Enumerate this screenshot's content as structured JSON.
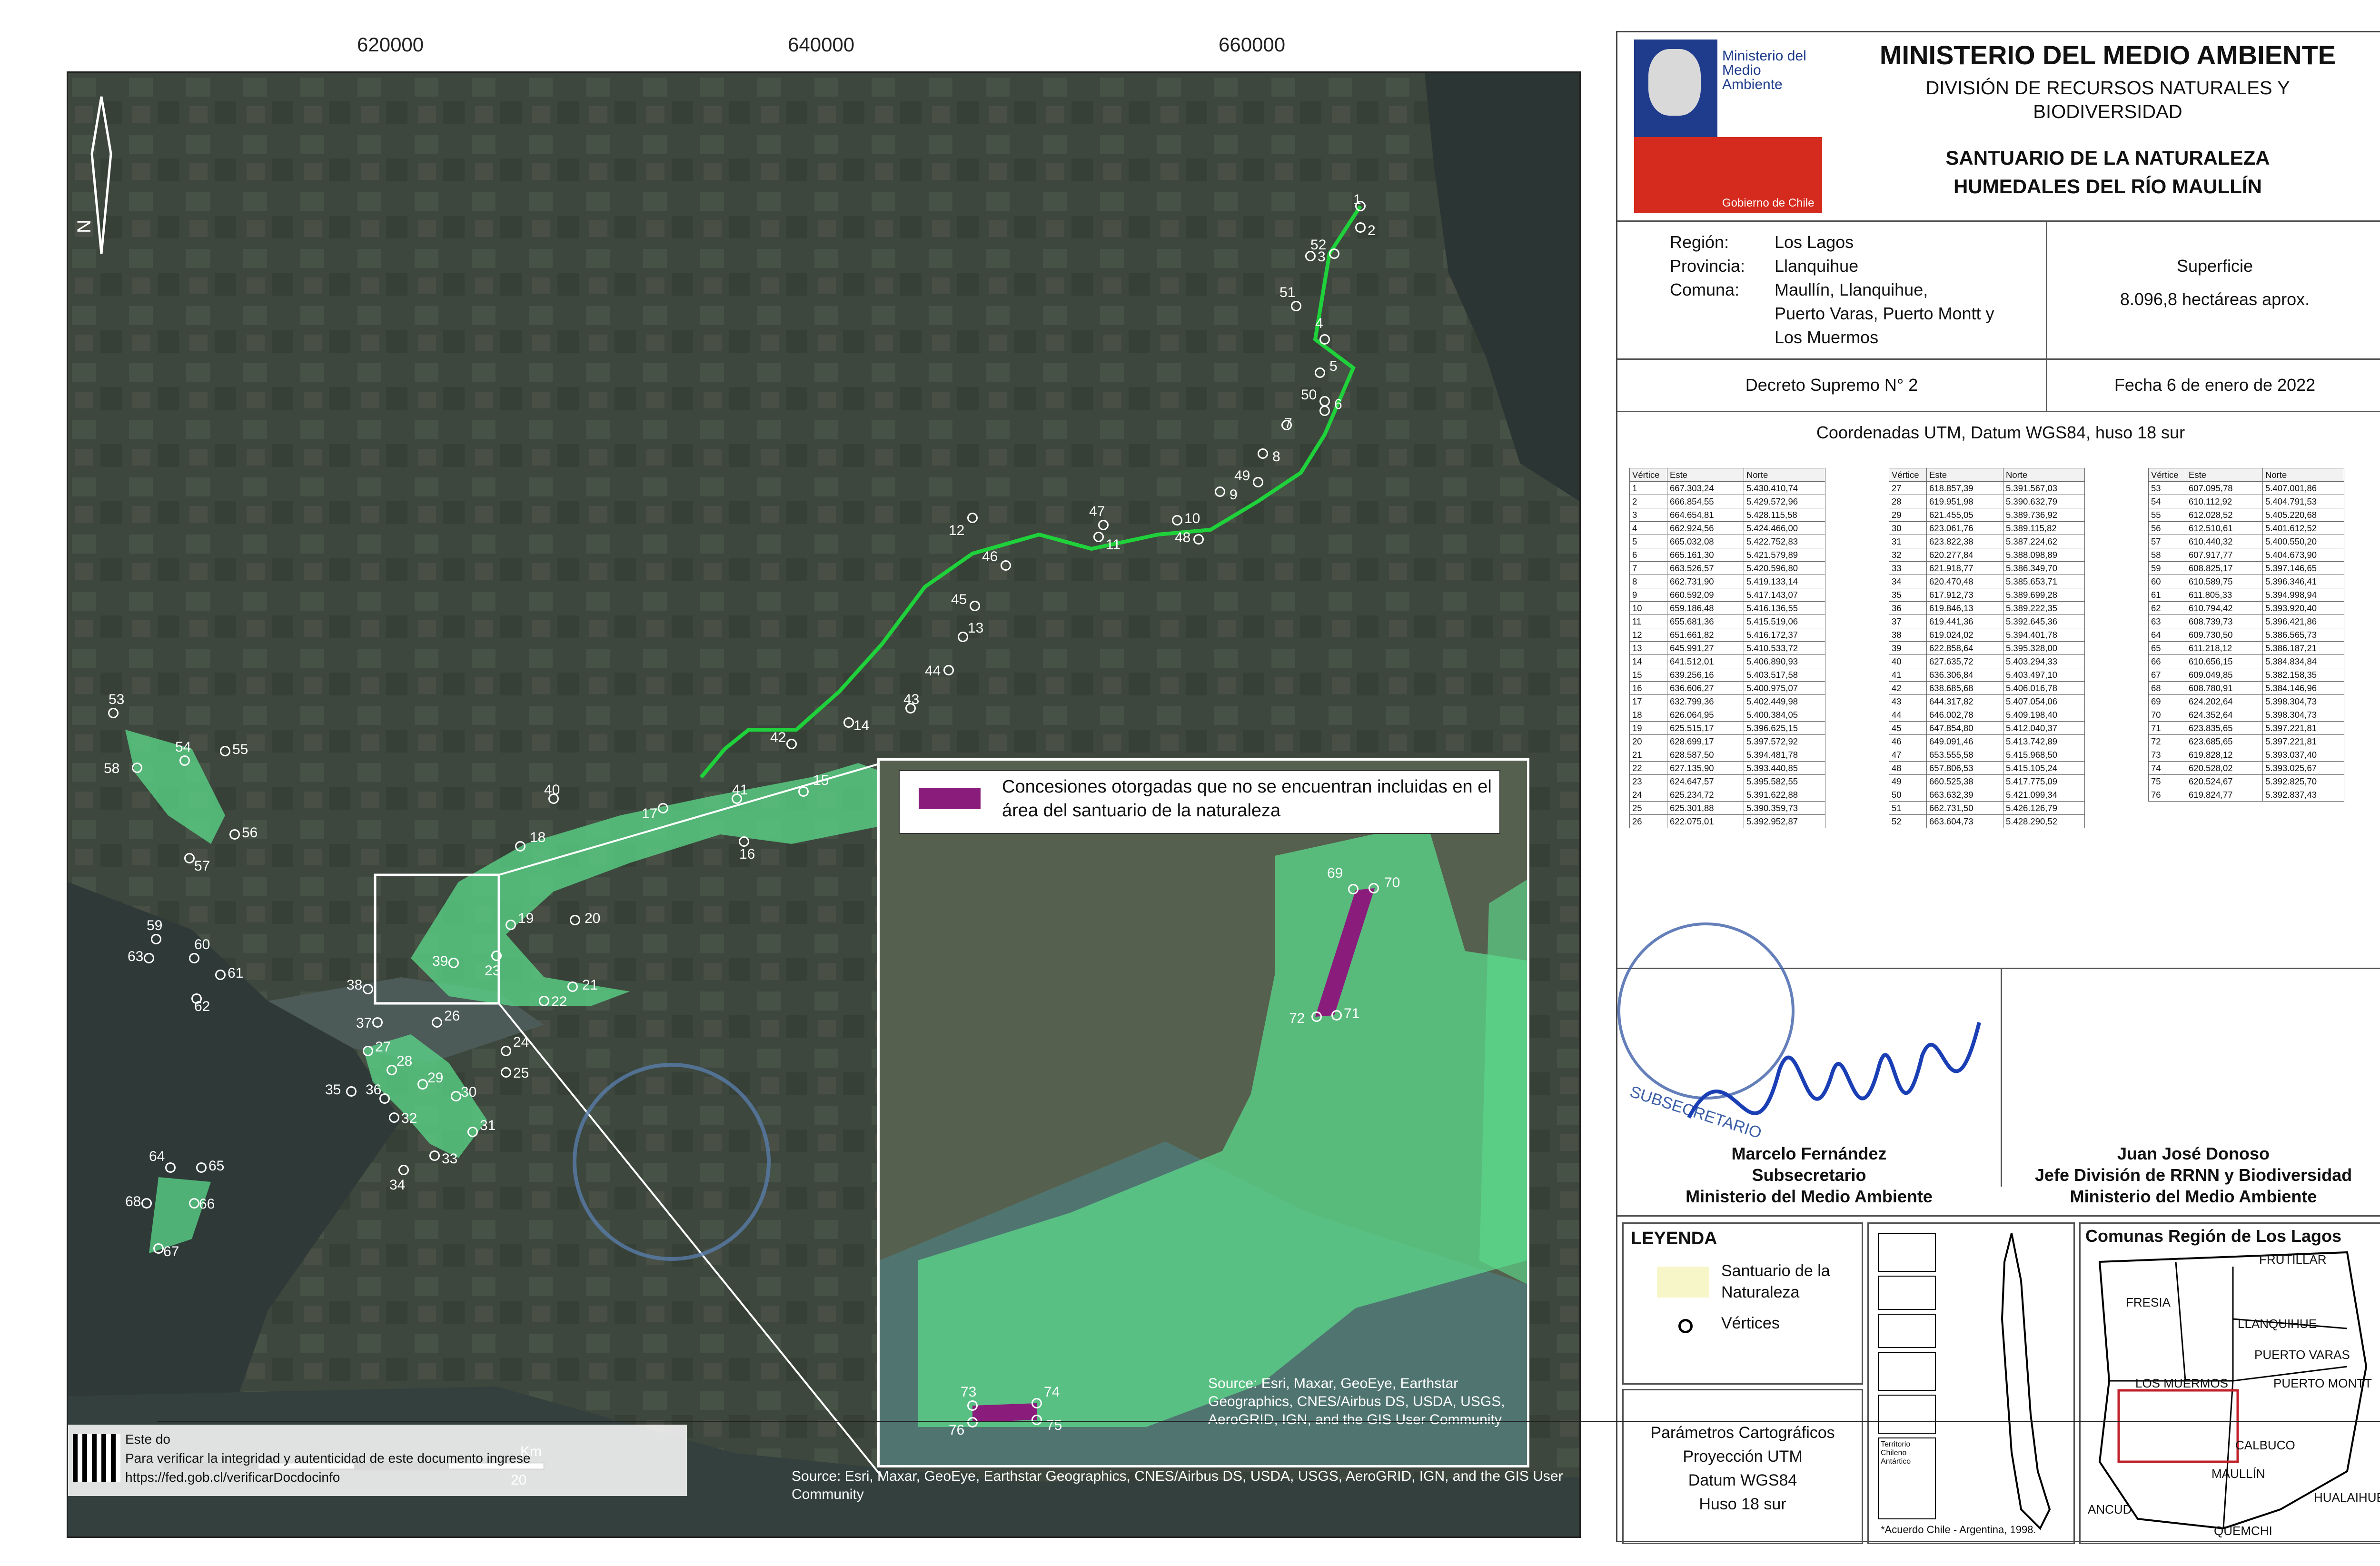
{
  "map": {
    "x_ticks": [
      "620000",
      "640000",
      "660000"
    ],
    "north_label": "N",
    "inset_legend": "Concesiones otorgadas que no se encuentran incluidas en el área del santuario de la naturaleza",
    "inset_attribution": "Source: Esri, Maxar, GeoEye, Earthstar Geographics, CNES/Airbus DS, USDA, USGS, AeroGRID, IGN, and the GIS User Community",
    "map_attribution": "Source: Esri, Maxar, GeoEye, Earthstar Geographics, CNES/Airbus DS, USDA, USGS, AeroGRID, IGN, and the GIS User Community",
    "scale_unit": "Km",
    "scale_value": "20",
    "verify_line1": "Este do",
    "verify_line2": "Para verificar la integridad y autenticidad de este documento ingrese",
    "verify_url": "https://fed.gob.cl/verificarDocdocinfo",
    "colors": {
      "sanctuary": "#5bd98a",
      "route": "#1fd13a",
      "concession": "#8a1c7c"
    }
  },
  "header": {
    "logo_text": "Ministerio del Medio Ambiente",
    "logo_footer": "Gobierno de Chile",
    "ministry": "MINISTERIO DEL MEDIO AMBIENTE",
    "division_line1": "DIVISIÓN DE RECURSOS NATURALES Y",
    "division_line2": "BIODIVERSIDAD",
    "title_line1": "SANTUARIO DE LA NATURALEZA",
    "title_line2": "HUMEDALES DEL RÍO MAULLÍN"
  },
  "info": {
    "region_label": "Región:",
    "region_value": "Los Lagos",
    "provincia_label": "Provincia:",
    "provincia_value": "Llanquihue",
    "comuna_label": "Comuna:",
    "comuna_value_line1": "Maullín, Llanquihue,",
    "comuna_value_line2": "Puerto Varas, Puerto Montt y",
    "comuna_value_line3": "Los Muermos",
    "superficie_label": "Superficie",
    "superficie_value": "8.096,8 hectáreas aprox.",
    "decreto": "Decreto Supremo N° 2",
    "fecha": "Fecha 6 de enero de 2022",
    "coords_title": "Coordenadas UTM, Datum WGS84, huso 18 sur"
  },
  "coords_headers": [
    "Vértice",
    "Este",
    "Norte"
  ],
  "coords": [
    [
      "1",
      "667.303,24",
      "5.430.410,74"
    ],
    [
      "2",
      "666.854,55",
      "5.429.572,96"
    ],
    [
      "3",
      "664.654,81",
      "5.428.115,58"
    ],
    [
      "4",
      "662.924,56",
      "5.424.466,00"
    ],
    [
      "5",
      "665.032,08",
      "5.422.752,83"
    ],
    [
      "6",
      "665.161,30",
      "5.421.579,89"
    ],
    [
      "7",
      "663.526,57",
      "5.420.596,80"
    ],
    [
      "8",
      "662.731,90",
      "5.419.133,14"
    ],
    [
      "9",
      "660.592,09",
      "5.417.143,07"
    ],
    [
      "10",
      "659.186,48",
      "5.416.136,55"
    ],
    [
      "11",
      "655.681,36",
      "5.415.519,06"
    ],
    [
      "12",
      "651.661,82",
      "5.416.172,37"
    ],
    [
      "13",
      "645.991,27",
      "5.410.533,72"
    ],
    [
      "14",
      "641.512,01",
      "5.406.890,93"
    ],
    [
      "15",
      "639.256,16",
      "5.403.517,58"
    ],
    [
      "16",
      "636.606,27",
      "5.400.975,07"
    ],
    [
      "17",
      "632.799,36",
      "5.402.449,98"
    ],
    [
      "18",
      "626.064,95",
      "5.400.384,05"
    ],
    [
      "19",
      "625.515,17",
      "5.396.625,15"
    ],
    [
      "20",
      "628.699,17",
      "5.397.572,92"
    ],
    [
      "21",
      "628.587,50",
      "5.394.481,78"
    ],
    [
      "22",
      "627.135,90",
      "5.393.440,85"
    ],
    [
      "23",
      "624.647,57",
      "5.395.582,55"
    ],
    [
      "24",
      "625.234,72",
      "5.391.622,88"
    ],
    [
      "25",
      "625.301,88",
      "5.390.359,73"
    ],
    [
      "26",
      "622.075,01",
      "5.392.952,87"
    ],
    [
      "27",
      "618.857,39",
      "5.391.567,03"
    ],
    [
      "28",
      "619.951,98",
      "5.390.632,79"
    ],
    [
      "29",
      "621.455,05",
      "5.389.736,92"
    ],
    [
      "30",
      "623.061,76",
      "5.389.115,82"
    ],
    [
      "31",
      "623.822,38",
      "5.387.224,62"
    ],
    [
      "32",
      "620.277,84",
      "5.388.098,89"
    ],
    [
      "33",
      "621.918,77",
      "5.386.349,70"
    ],
    [
      "34",
      "620.470,48",
      "5.385.653,71"
    ],
    [
      "35",
      "617.912,73",
      "5.389.699,28"
    ],
    [
      "36",
      "619.846,13",
      "5.389.222,35"
    ],
    [
      "37",
      "619.441,36",
      "5.392.645,36"
    ],
    [
      "38",
      "619.024,02",
      "5.394.401,78"
    ],
    [
      "39",
      "622.858,64",
      "5.395.328,00"
    ],
    [
      "40",
      "627.635,72",
      "5.403.294,33"
    ],
    [
      "41",
      "636.306,84",
      "5.403.497,10"
    ],
    [
      "42",
      "638.685,68",
      "5.406.016,78"
    ],
    [
      "43",
      "644.317,82",
      "5.407.054,06"
    ],
    [
      "44",
      "646.002,78",
      "5.409.198,40"
    ],
    [
      "45",
      "647.854,80",
      "5.412.040,37"
    ],
    [
      "46",
      "649.091,46",
      "5.413.742,89"
    ],
    [
      "47",
      "653.555,58",
      "5.415.968,50"
    ],
    [
      "48",
      "657.806,53",
      "5.415.105,24"
    ],
    [
      "49",
      "660.525,38",
      "5.417.775,09"
    ],
    [
      "50",
      "663.632,39",
      "5.421.099,34"
    ],
    [
      "51",
      "662.731,50",
      "5.426.126,79"
    ],
    [
      "52",
      "663.604,73",
      "5.428.290,52"
    ],
    [
      "53",
      "607.095,78",
      "5.407.001,86"
    ],
    [
      "54",
      "610.112,92",
      "5.404.791,53"
    ],
    [
      "55",
      "612.028,52",
      "5.405.220,68"
    ],
    [
      "56",
      "612.510,61",
      "5.401.612,52"
    ],
    [
      "57",
      "610.440,32",
      "5.400.550,20"
    ],
    [
      "58",
      "607.917,77",
      "5.404.673,90"
    ],
    [
      "59",
      "608.825,17",
      "5.397.146,65"
    ],
    [
      "60",
      "610.589,75",
      "5.396.346,41"
    ],
    [
      "61",
      "611.805,33",
      "5.394.998,94"
    ],
    [
      "62",
      "610.794,42",
      "5.393.920,40"
    ],
    [
      "63",
      "608.739,73",
      "5.396.421,86"
    ],
    [
      "64",
      "609.730,50",
      "5.386.565,73"
    ],
    [
      "65",
      "611.218,12",
      "5.386.187,21"
    ],
    [
      "66",
      "610.656,15",
      "5.384.834,84"
    ],
    [
      "67",
      "609.049,85",
      "5.382.158,35"
    ],
    [
      "68",
      "608.780,91",
      "5.384.146,96"
    ],
    [
      "69",
      "624.202,64",
      "5.398.304,73"
    ],
    [
      "70",
      "624.352,64",
      "5.398.304,73"
    ],
    [
      "71",
      "623.835,65",
      "5.397.221,81"
    ],
    [
      "72",
      "623.685,65",
      "5.397.221,81"
    ],
    [
      "73",
      "619.828,12",
      "5.393.037,40"
    ],
    [
      "74",
      "620.528,02",
      "5.393.025,67"
    ],
    [
      "75",
      "620.524,67",
      "5.392.825,70"
    ],
    [
      "76",
      "619.824,77",
      "5.392.837,43"
    ]
  ],
  "signatures": {
    "left_name": "Marcelo Fernández",
    "left_role": "Subsecretario",
    "left_org": "Ministerio del Medio Ambiente",
    "right_name": "Juan José Donoso",
    "right_role": "Jefe División de RRNN y Biodiversidad",
    "right_org": "Ministerio del Medio Ambiente",
    "stamp_text": "SUBSECRETARIO"
  },
  "legend": {
    "title": "LEYENDA",
    "item1_line1": "Santuario de la",
    "item1_line2": "Naturaleza",
    "item2": "Vértices",
    "item1_color": "#f7f6c8"
  },
  "params": {
    "title": "Parámetros Cartográficos",
    "line1": "Proyección UTM",
    "line2": "Datum WGS84",
    "line3": "Huso 18 sur"
  },
  "chile_map": {
    "footnote": "*Acuerdo Chile - Argentina, 1998.",
    "territory_label": "Territorio Chileno Antártico"
  },
  "comunas_map": {
    "title": "Comunas Región de Los Lagos",
    "labels": [
      "FRUTILLAR",
      "FRESIA",
      "LLANQUIHUE",
      "PUERTO VARAS",
      "LOS MUERMOS",
      "PUERTO MONTT",
      "CALBUCO",
      "MAULLÍN",
      "ANCUD",
      "HUALAIHUÉ",
      "QUEMCHI"
    ]
  }
}
